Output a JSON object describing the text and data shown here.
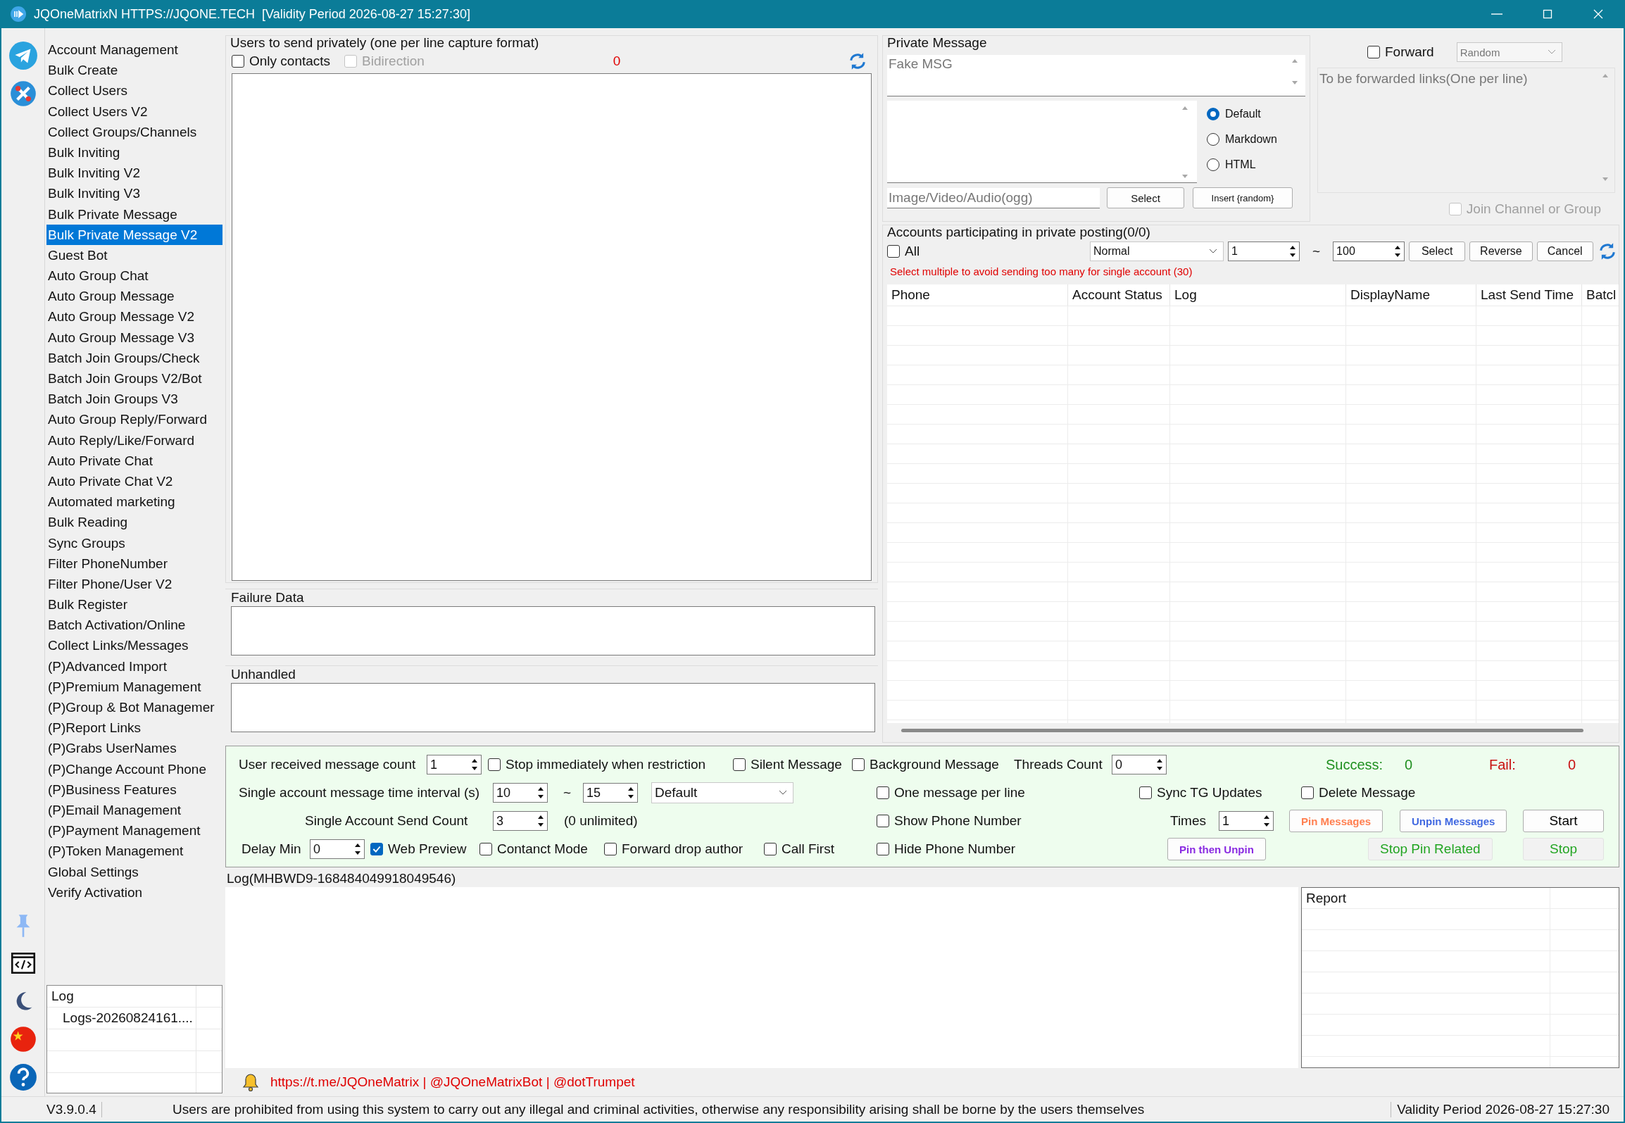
{
  "window": {
    "title": "JQOneMatrixN HTTPS://JQONE.TECH  [Validity Period 2026-08-27 15:27:30]"
  },
  "sidebar": {
    "items": [
      {
        "label": "Account Management",
        "selected": false
      },
      {
        "label": "Bulk Create",
        "selected": false
      },
      {
        "label": "Collect Users",
        "selected": false
      },
      {
        "label": "Collect Users V2",
        "selected": false
      },
      {
        "label": "Collect Groups/Channels",
        "selected": false
      },
      {
        "label": "Bulk Inviting",
        "selected": false
      },
      {
        "label": "Bulk Inviting V2",
        "selected": false
      },
      {
        "label": "Bulk Inviting V3",
        "selected": false
      },
      {
        "label": "Bulk Private Message",
        "selected": false
      },
      {
        "label": "Bulk Private Message V2",
        "selected": true
      },
      {
        "label": "Guest Bot",
        "selected": false
      },
      {
        "label": "Auto Group Chat",
        "selected": false
      },
      {
        "label": "Auto Group Message",
        "selected": false
      },
      {
        "label": "Auto Group Message V2",
        "selected": false
      },
      {
        "label": "Auto Group Message V3",
        "selected": false
      },
      {
        "label": "Batch Join Groups/Check",
        "selected": false
      },
      {
        "label": "Batch Join Groups V2/Bot",
        "selected": false
      },
      {
        "label": "Batch Join Groups V3",
        "selected": false
      },
      {
        "label": "Auto Group Reply/Forward",
        "selected": false
      },
      {
        "label": "Auto Reply/Like/Forward",
        "selected": false
      },
      {
        "label": "Auto Private Chat",
        "selected": false
      },
      {
        "label": "Auto Private Chat V2",
        "selected": false
      },
      {
        "label": "Automated marketing",
        "selected": false
      },
      {
        "label": "Bulk Reading",
        "selected": false
      },
      {
        "label": "Sync Groups",
        "selected": false
      },
      {
        "label": "Filter PhoneNumber",
        "selected": false
      },
      {
        "label": "Filter Phone/User V2",
        "selected": false
      },
      {
        "label": "Bulk Register",
        "selected": false
      },
      {
        "label": "Batch Activation/Online",
        "selected": false
      },
      {
        "label": "Collect Links/Messages",
        "selected": false
      },
      {
        "label": "(P)Advanced Import",
        "selected": false
      },
      {
        "label": "(P)Premium Management",
        "selected": false
      },
      {
        "label": "(P)Group & Bot Managemer",
        "selected": false
      },
      {
        "label": "(P)Report Links",
        "selected": false
      },
      {
        "label": "(P)Grabs UserNames",
        "selected": false
      },
      {
        "label": "(P)Change Account Phone",
        "selected": false
      },
      {
        "label": "(P)Business Features",
        "selected": false
      },
      {
        "label": "(P)Email Management",
        "selected": false
      },
      {
        "label": "(P)Payment Management",
        "selected": false
      },
      {
        "label": "(P)Token Management",
        "selected": false
      },
      {
        "label": "Global Settings",
        "selected": false
      },
      {
        "label": "Verify Activation",
        "selected": false
      }
    ],
    "log_panel": {
      "title": "Log",
      "items": [
        "Logs-20260824161...."
      ]
    }
  },
  "recipients": {
    "title": "Users to send privately (one per line capture format)",
    "options": [
      {
        "label": "Only contacts",
        "checked": false,
        "disabled": false
      },
      {
        "label": "Bidirection",
        "checked": false,
        "disabled": true
      }
    ],
    "count": "0"
  },
  "failure_data": {
    "title": "Failure Data"
  },
  "unhandled": {
    "title": "Unhandled"
  },
  "private_message": {
    "title": "Private Message",
    "message_placeholder": "Fake MSG",
    "formats": [
      {
        "label": "Default",
        "selected": true
      },
      {
        "label": "Markdown",
        "selected": false
      },
      {
        "label": "HTML",
        "selected": false
      }
    ],
    "media_placeholder": "Image/Video/Audio(ogg)",
    "select_button": "Select",
    "insert_button": "Insert {random}"
  },
  "forward": {
    "option": {
      "label": "Forward",
      "checked": false
    },
    "mode": "Random",
    "links_placeholder": "To be forwarded links(One per line)",
    "join": {
      "label": "Join Channel or Group",
      "checked": false,
      "disabled": true
    }
  },
  "accounts": {
    "title": "Accounts participating in private posting(0/0)",
    "all": {
      "label": "All",
      "checked": false
    },
    "filter": "Normal",
    "from": "1",
    "separator": "~",
    "to": "100",
    "buttons": [
      "Select",
      "Reverse",
      "Cancel"
    ],
    "hint": "Select multiple to avoid sending too many for single account (30)",
    "table": {
      "columns": [
        "Phone",
        "Account Status",
        "Log",
        "DisplayName",
        "Last Send Time",
        "Batcl"
      ]
    }
  },
  "settings": {
    "lines": [
      {
        "items": [
          {
            "kind": "text",
            "text": "User received message count"
          },
          {
            "kind": "spin",
            "value": "1"
          },
          {
            "kind": "checkbox",
            "label": "Stop immediately when restriction",
            "checked": false
          },
          {
            "kind": "checkbox",
            "label": "Silent Message",
            "checked": false
          },
          {
            "kind": "checkbox",
            "label": "Background Message",
            "checked": false
          },
          {
            "kind": "text",
            "text": "Threads Count"
          },
          {
            "kind": "spin",
            "value": "0"
          },
          {
            "kind": "stat",
            "label": "Success:",
            "value": "0",
            "color": "#1f8f1f"
          },
          {
            "kind": "stat",
            "label": "Fail:",
            "value": "0",
            "color": "#c81010"
          }
        ]
      },
      {
        "items": [
          {
            "kind": "text",
            "text": "Single account message time interval (s)"
          },
          {
            "kind": "spin",
            "value": "10"
          },
          {
            "kind": "text",
            "text": "~"
          },
          {
            "kind": "spin",
            "value": "15"
          },
          {
            "kind": "select",
            "value": "Default"
          },
          {
            "kind": "checkbox",
            "label": "One message per line",
            "checked": false
          },
          {
            "kind": "checkbox",
            "label": "Sync TG Updates",
            "checked": false
          },
          {
            "kind": "checkbox",
            "label": "Delete Message",
            "checked": false
          }
        ]
      },
      {
        "items": [
          {
            "kind": "text",
            "text": "Single Account Send Count"
          },
          {
            "kind": "spin",
            "value": "3"
          },
          {
            "kind": "text",
            "text": "(0 unlimited)"
          },
          {
            "kind": "checkbox",
            "label": "Show Phone Number",
            "checked": false
          },
          {
            "kind": "text",
            "text": "Times"
          },
          {
            "kind": "spin",
            "value": "1"
          },
          {
            "kind": "button",
            "label": "Pin Messages",
            "color": "#ff7f50",
            "disabled": false
          },
          {
            "kind": "button",
            "label": "Unpin Messages",
            "color": "#4169e1",
            "disabled": false
          },
          {
            "kind": "button",
            "label": "Start",
            "color": "#000000",
            "disabled": false
          }
        ]
      },
      {
        "items": [
          {
            "kind": "text",
            "text": "Delay Min"
          },
          {
            "kind": "spin",
            "value": "0"
          },
          {
            "kind": "checkbox",
            "label": "Web Preview",
            "checked": true
          },
          {
            "kind": "checkbox",
            "label": "Contanct Mode",
            "checked": false
          },
          {
            "kind": "checkbox",
            "label": "Forward drop author",
            "checked": false
          },
          {
            "kind": "checkbox",
            "label": "Call First",
            "checked": false
          },
          {
            "kind": "checkbox",
            "label": "Hide Phone Number",
            "checked": false
          },
          {
            "kind": "button",
            "label": "Pin then Unpin",
            "color": "#8a2be2",
            "disabled": false
          },
          {
            "kind": "button",
            "label": "Stop Pin Related",
            "color": "#22a522",
            "disabled": true
          },
          {
            "kind": "button",
            "label": "Stop",
            "color": "#22a522",
            "disabled": true
          }
        ]
      }
    ]
  },
  "log": {
    "title": "Log(MHBWD9-168484049918049546)",
    "report_column": "Report"
  },
  "footer": {
    "links": "https://t.me/JQOneMatrix | @JQOneMatrixBot | @dotTrumpet"
  },
  "status_bar": {
    "version": "V3.9.0.4",
    "notice": "Users are prohibited from using this system to carry out any illegal and criminal activities, otherwise any responsibility arising shall be borne by the users themselves",
    "validity": "Validity Period 2026-08-27 15:27:30"
  }
}
